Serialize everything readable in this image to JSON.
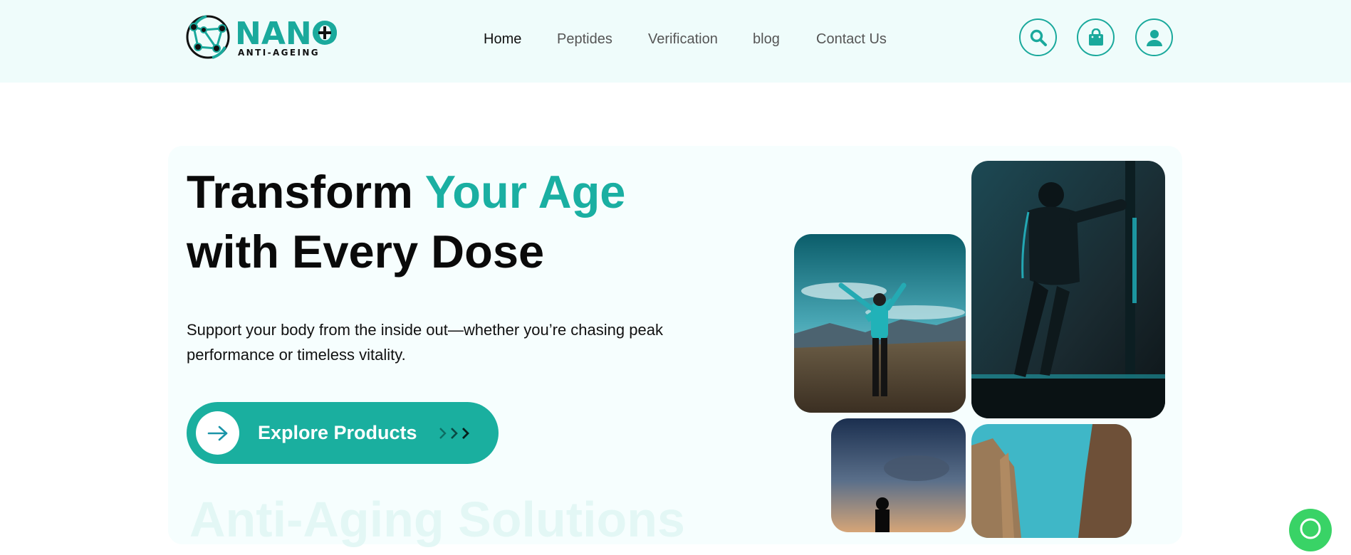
{
  "brand": {
    "name": "NANO",
    "tagline": "ANTI-AGEING"
  },
  "nav": {
    "items": [
      {
        "label": "Home",
        "active": true
      },
      {
        "label": "Peptides",
        "active": false
      },
      {
        "label": "Verification",
        "active": false
      },
      {
        "label": "blog",
        "active": false
      },
      {
        "label": "Contact Us",
        "active": false
      }
    ]
  },
  "header_icons": [
    "search-icon",
    "shopping-bag-icon",
    "user-icon"
  ],
  "hero": {
    "title_part1": "Transform ",
    "title_accent": "Your Age",
    "title_line2": "with Every Dose",
    "subtitle": "Support your body from the inside out—whether you’re chasing peak performance or timeless vitality.",
    "cta_label": "Explore Products",
    "section_heading": "Anti-Aging Solutions"
  },
  "colors": {
    "accent": "#1aa99c",
    "header_bg": "#effcfb",
    "cta_bg": "#1aaf9f",
    "whatsapp": "#39d366"
  }
}
